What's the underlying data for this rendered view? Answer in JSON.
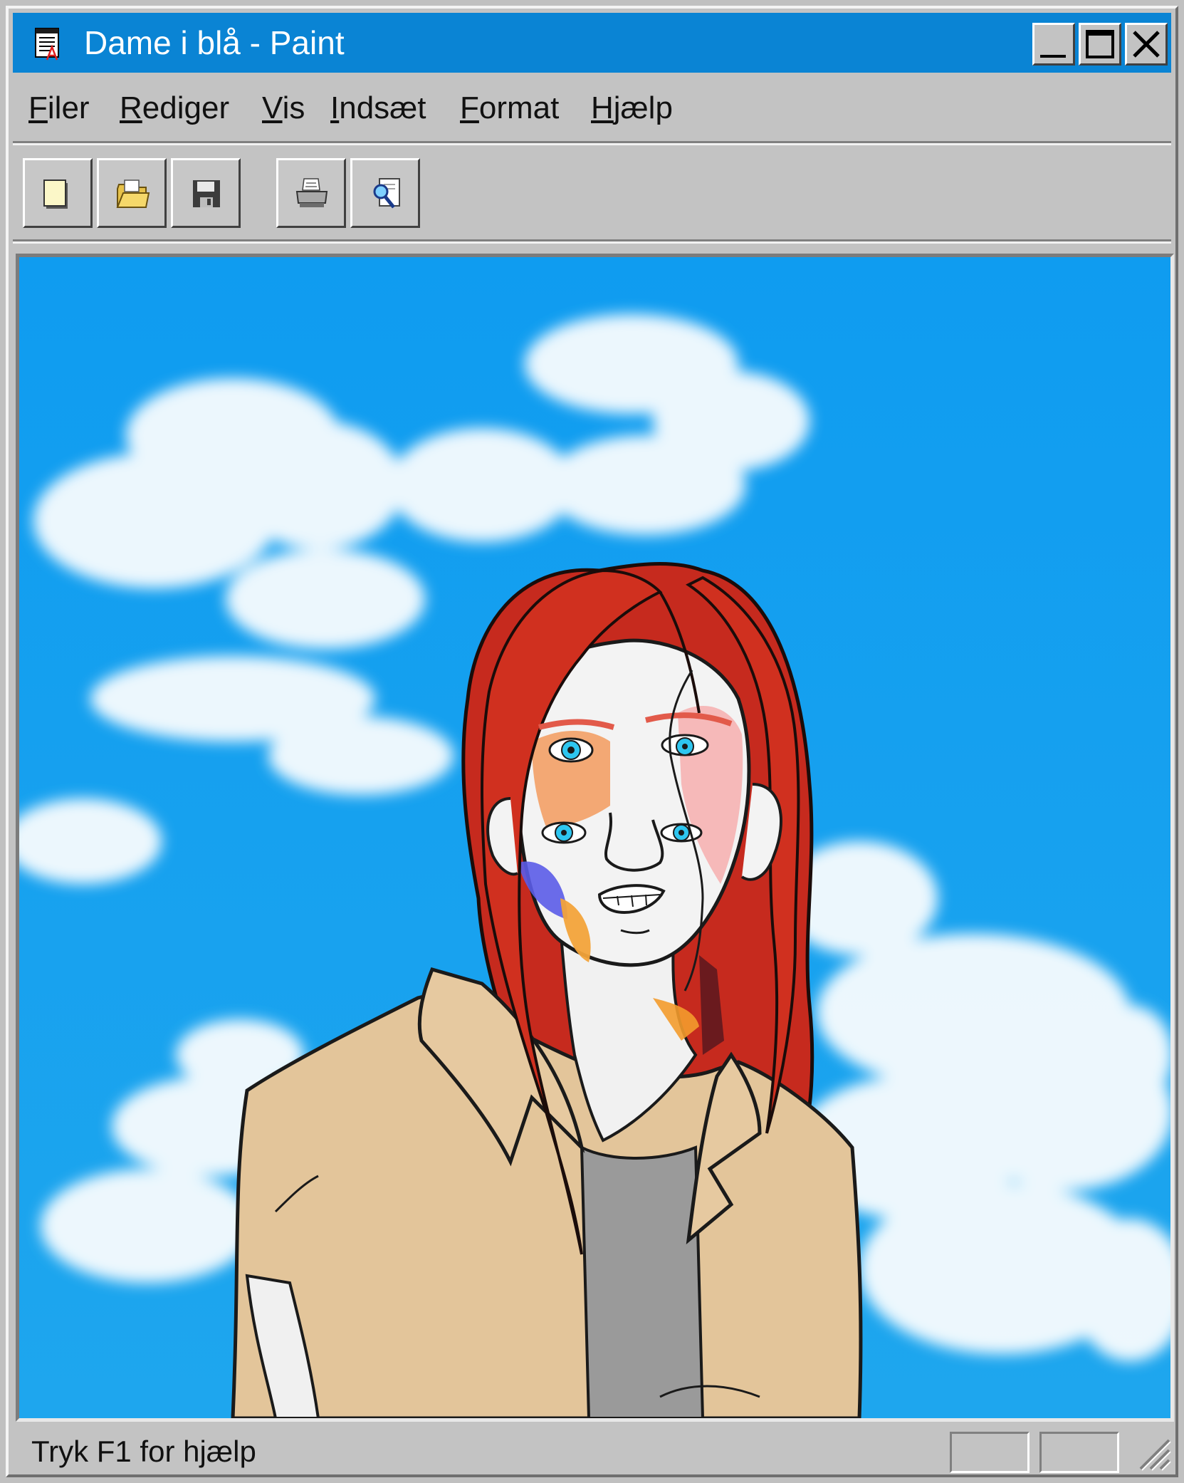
{
  "window": {
    "title": "Dame i blå - Paint",
    "app_icon": "notepad-icon",
    "controls": [
      "minimize-icon",
      "maximize-icon",
      "close-icon"
    ]
  },
  "menu": {
    "items": [
      {
        "label": "Filer"
      },
      {
        "label": "Rediger"
      },
      {
        "label": "Vis"
      },
      {
        "label": "Indsæt"
      },
      {
        "label": "Format"
      },
      {
        "label": "Hjælp"
      }
    ]
  },
  "toolbar": {
    "buttons": [
      {
        "icon": "new-document-icon"
      },
      {
        "icon": "open-folder-icon"
      },
      {
        "icon": "save-disk-icon"
      },
      {
        "icon": "print-icon"
      },
      {
        "icon": "print-preview-icon"
      }
    ]
  },
  "canvas": {
    "sky_color": "#16a0ee",
    "hair_color": "#c62a1e",
    "jacket_color": "#e3c59a",
    "shirt_color": "#9a9a9a",
    "eye_color": "#2ec6f0"
  },
  "status": {
    "text": "Tryk F1 for hjælp"
  }
}
